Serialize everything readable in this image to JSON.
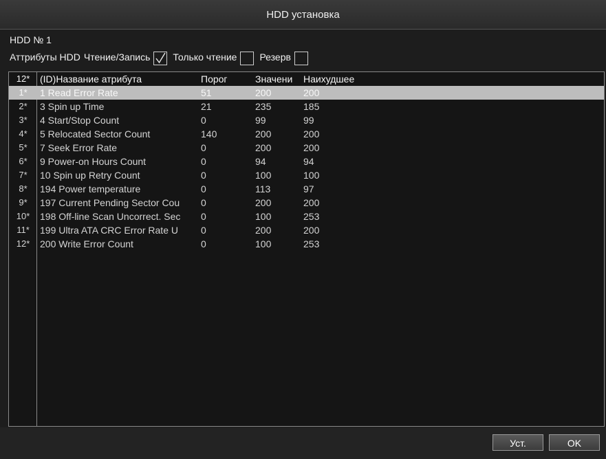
{
  "window": {
    "title": "HDD установка"
  },
  "hdd": {
    "number_label": "HDD № 1"
  },
  "attributes": {
    "label": "Аттрибуты HDD",
    "read_write": {
      "label": "Чтение/Запись",
      "checked": true
    },
    "read_only": {
      "label": "Только чтение",
      "checked": false
    },
    "reserve": {
      "label": "Резерв",
      "checked": false
    }
  },
  "table": {
    "columns": {
      "index": "12*",
      "name": "(ID)Название атрибута",
      "threshold": "Порог",
      "value": "Значени",
      "worst": "Наихудшее"
    },
    "rows": [
      {
        "index": "1*",
        "name": " 1 Read Error Rate",
        "threshold": "51",
        "value": "200",
        "worst": "200"
      },
      {
        "index": "2*",
        "name": " 3 Spin up Time",
        "threshold": "21",
        "value": "235",
        "worst": "185"
      },
      {
        "index": "3*",
        "name": " 4 Start/Stop Count",
        "threshold": "0",
        "value": "99",
        "worst": "99"
      },
      {
        "index": "4*",
        "name": " 5 Relocated Sector Count",
        "threshold": "140",
        "value": "200",
        "worst": "200"
      },
      {
        "index": "5*",
        "name": " 7 Seek Error Rate",
        "threshold": "0",
        "value": "200",
        "worst": "200"
      },
      {
        "index": "6*",
        "name": " 9 Power-on Hours Count",
        "threshold": "0",
        "value": "94",
        "worst": "94"
      },
      {
        "index": "7*",
        "name": " 10 Spin up Retry Count",
        "threshold": "0",
        "value": "100",
        "worst": "100"
      },
      {
        "index": "8*",
        "name": "194 Power temperature",
        "threshold": "0",
        "value": "113",
        "worst": "97"
      },
      {
        "index": "9*",
        "name": "197 Current Pending Sector Cou",
        "threshold": "0",
        "value": "200",
        "worst": "200"
      },
      {
        "index": "10*",
        "name": "198 Off-line Scan Uncorrect. Sec",
        "threshold": "0",
        "value": "100",
        "worst": "253"
      },
      {
        "index": "11*",
        "name": "199 Ultra ATA CRC Error Rate U",
        "threshold": "0",
        "value": "200",
        "worst": "200"
      },
      {
        "index": "12*",
        "name": "200 Write Error Count",
        "threshold": "0",
        "value": "100",
        "worst": "253"
      }
    ]
  },
  "buttons": {
    "set_label": "Уст.",
    "ok_label": "OK"
  },
  "colors": {
    "selected_row": "#bdbdbd",
    "background": "#1d1d1d",
    "border": "#8a8a8a"
  }
}
